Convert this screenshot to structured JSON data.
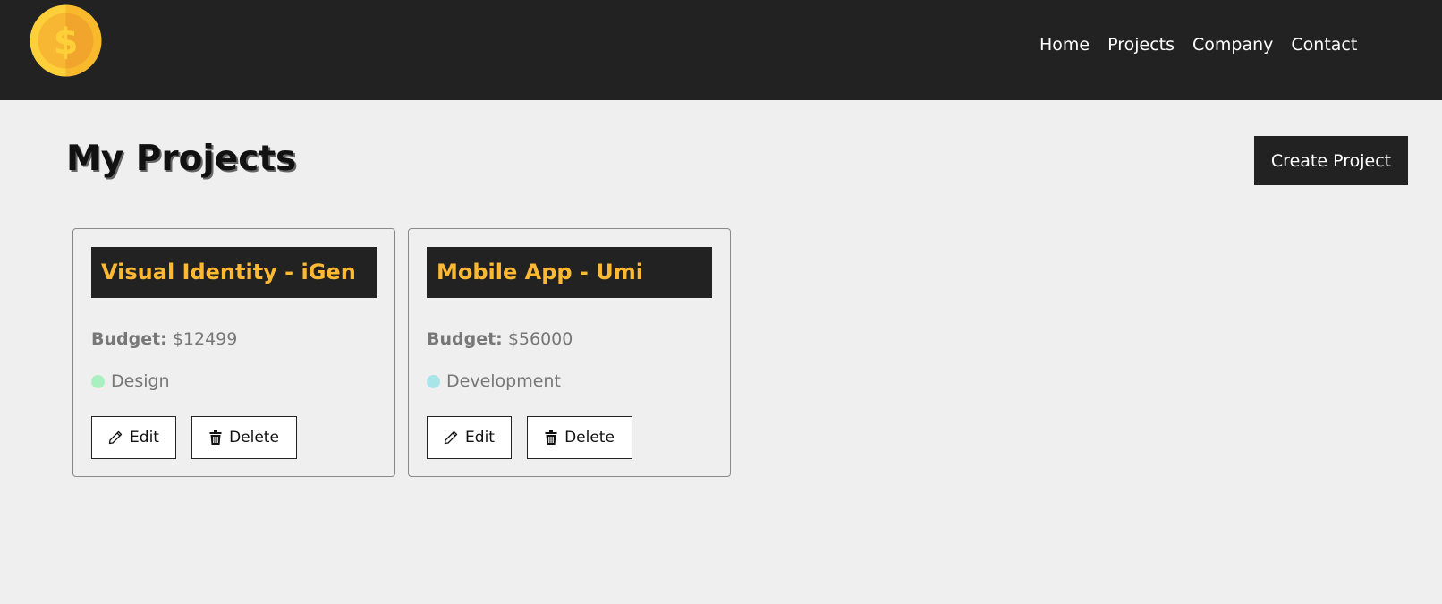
{
  "header": {
    "logo_icon": "dollar-coin-icon",
    "nav": [
      {
        "label": "Home"
      },
      {
        "label": "Projects"
      },
      {
        "label": "Company"
      },
      {
        "label": "Contact"
      }
    ]
  },
  "main": {
    "title": "My Projects",
    "create_button_label": "Create Project"
  },
  "projects": [
    {
      "name": "Visual Identity - iGen",
      "budget_label": "Budget:",
      "budget_value": "$12499",
      "category": "Design",
      "category_color": "#a8f0c0",
      "edit_label": "Edit",
      "delete_label": "Delete"
    },
    {
      "name": "Mobile App - Umi",
      "budget_label": "Budget:",
      "budget_value": "$56000",
      "category": "Development",
      "category_color": "#a8e4e8",
      "edit_label": "Edit",
      "delete_label": "Delete"
    }
  ],
  "colors": {
    "navbar": "#222222",
    "accent_title": "#fdb932",
    "background": "#efefef"
  }
}
